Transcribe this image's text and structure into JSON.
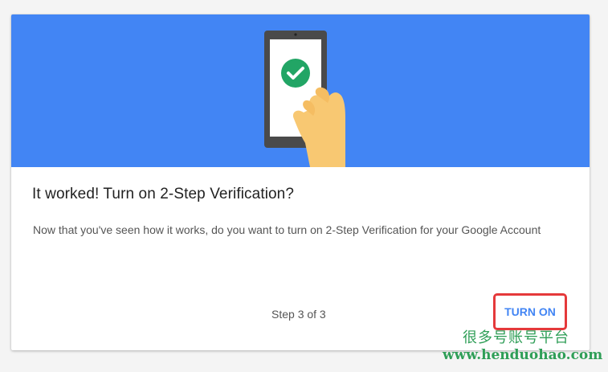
{
  "dialog": {
    "title": "It worked! Turn on 2-Step Verification?",
    "description": "Now that you've seen how it works, do you want to turn on 2-Step Verification for your Google Account",
    "step_text": "Step 3 of 3",
    "turn_on_label": "TURN ON"
  },
  "illustration": {
    "icon": "phone-check-icon",
    "hand": "hand-icon"
  },
  "watermark": {
    "cn": "很多号账号平台",
    "url": "www.henduohao.com"
  },
  "colors": {
    "hero_bg": "#4285f4",
    "check_green": "#22a565",
    "accent_blue": "#4285f4",
    "highlight_red": "#e5393b",
    "watermark_green": "#2f9e57"
  }
}
